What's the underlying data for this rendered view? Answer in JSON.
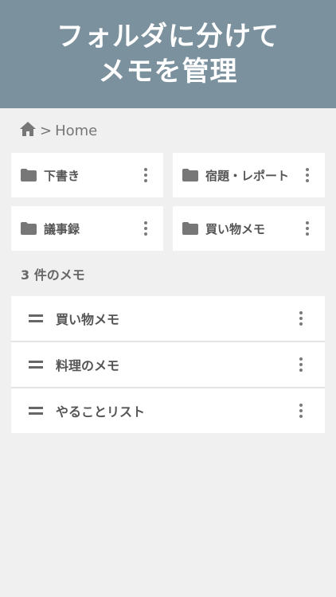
{
  "banner": {
    "line1": "フォルダに分けて",
    "line2": "メモを管理"
  },
  "breadcrumb": {
    "separator": ">",
    "current": "Home",
    "home_icon": "home-icon"
  },
  "folders": [
    {
      "label": "下書き",
      "icon": "folder-icon"
    },
    {
      "label": "宿題・レポート",
      "icon": "folder-icon"
    },
    {
      "label": "議事録",
      "icon": "folder-icon"
    },
    {
      "label": "買い物メモ",
      "icon": "folder-icon"
    }
  ],
  "memo_count_label": "3 件のメモ",
  "memos": [
    {
      "title": "買い物メモ"
    },
    {
      "title": "料理のメモ"
    },
    {
      "title": "やることリスト"
    }
  ],
  "colors": {
    "banner": "#7c919e",
    "background": "#f0f0f0",
    "card": "#ffffff",
    "icon": "#777777"
  }
}
